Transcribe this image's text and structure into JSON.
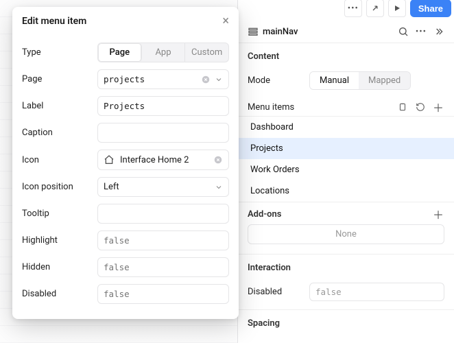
{
  "topbar": {
    "share_label": "Share"
  },
  "inspector": {
    "component_name": "mainNav",
    "content_label": "Content",
    "mode_label": "Mode",
    "mode_options": {
      "manual": "Manual",
      "mapped": "Mapped"
    },
    "mode_selected": "manual",
    "menu_items_label": "Menu items",
    "menu_items": [
      "Dashboard",
      "Projects",
      "Work Orders",
      "Locations"
    ],
    "menu_selected_index": 1,
    "addons_label": "Add-ons",
    "addons_none": "None",
    "interaction_label": "Interaction",
    "disabled_label": "Disabled",
    "disabled_value": "false",
    "spacing_label": "Spacing"
  },
  "dialog": {
    "title": "Edit menu item",
    "fields": {
      "type": {
        "label": "Type",
        "options": {
          "page": "Page",
          "app": "App",
          "custom": "Custom"
        },
        "selected": "page"
      },
      "page": {
        "label": "Page",
        "value": "projects"
      },
      "label": {
        "label": "Label",
        "value": "Projects"
      },
      "caption": {
        "label": "Caption",
        "value": ""
      },
      "icon": {
        "label": "Icon",
        "value": "Interface Home 2"
      },
      "icon_position": {
        "label": "Icon position",
        "value": "Left"
      },
      "tooltip": {
        "label": "Tooltip",
        "value": ""
      },
      "highlight": {
        "label": "Highlight",
        "placeholder": "false"
      },
      "hidden": {
        "label": "Hidden",
        "placeholder": "false"
      },
      "disabled": {
        "label": "Disabled",
        "placeholder": "false"
      }
    }
  }
}
